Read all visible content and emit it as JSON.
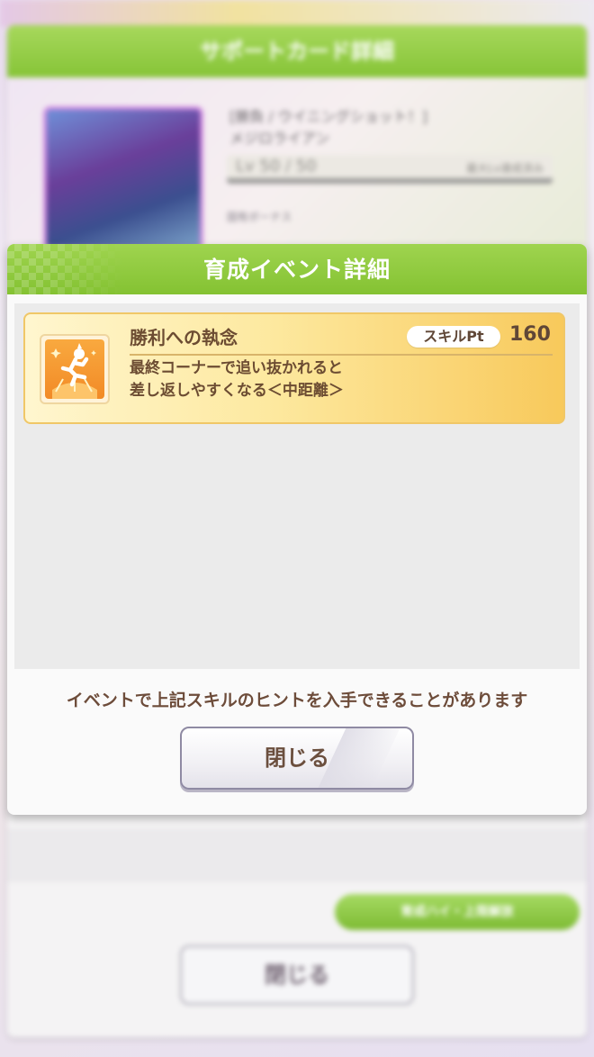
{
  "background": {
    "panel_title": "サポートカード詳細",
    "card_name_line1": "[勝負 / ウイニングショット！]",
    "card_name_line2": "メジロライアン",
    "level_text": "Lv 50 / 50",
    "level_right": "最大Lv達成済み",
    "bonus_label": "固有ボーナス",
    "green_button": "育成ハイ・上限解放",
    "close_button": "閉じる"
  },
  "dialog": {
    "title": "育成イベント詳細",
    "skill": {
      "icon": "running-horse-speed-icon",
      "name": "勝利への執念",
      "pt_label": "スキルPt",
      "pt_value": "160",
      "description_line1": "最終コーナーで追い抜かれると",
      "description_line2": "差し返しやすくなる＜中距離＞"
    },
    "hint": "イベントで上記スキルのヒントを入手できることがあります",
    "close_label": "閉じる"
  },
  "colors": {
    "header_green": "#8ac93a",
    "skill_gold": "#f8c95b",
    "text_brown": "#6c4c32"
  }
}
